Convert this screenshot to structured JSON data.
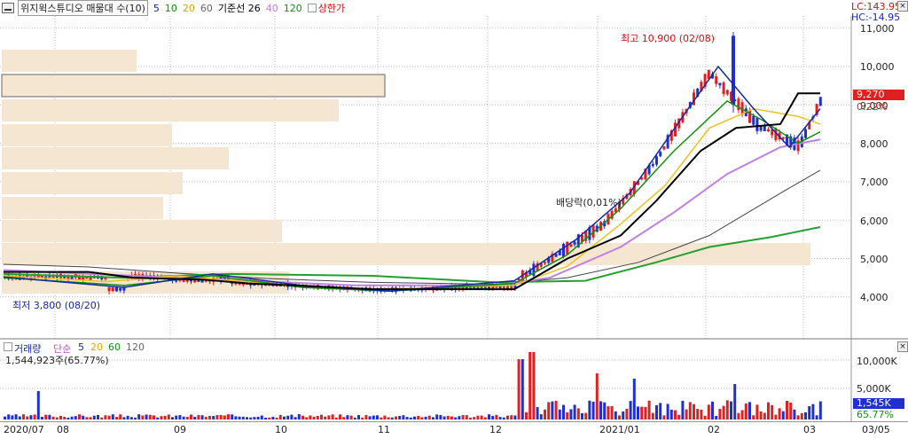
{
  "header": {
    "title": "위지윅스튜디오 매물대 수(10)",
    "ma_periods": [
      "5",
      "10",
      "20",
      "60"
    ],
    "kijun_label": "기준선 26",
    "extra_periods": [
      "40",
      "120"
    ],
    "limit_label": "상한가"
  },
  "corner": {
    "lc": "LC:143.95",
    "hc": "HC:-14.95"
  },
  "price_axis": {
    "ticks": [
      "11,000",
      "10,000",
      "9,000",
      "8,000",
      "7,000",
      "6,000",
      "5,000",
      "4,000"
    ]
  },
  "current": {
    "price": "9,270",
    "change": "0.22%"
  },
  "annotations": {
    "high": "최고 10,900 (02/08)",
    "low": "최저 3,800 (08/20)",
    "dividend": "배당락(0,01%)"
  },
  "volume": {
    "title": "거래량",
    "ma_label": "단순",
    "ma_periods": [
      "5",
      "20",
      "60",
      "120"
    ],
    "value": "1,544,923주(65.77%)",
    "axis_ticks": [
      "10,000K",
      "5,000K"
    ],
    "current": "1,545K",
    "current_pct": "65.77%"
  },
  "date_axis": {
    "ticks": [
      "2020/07",
      "08",
      "09",
      "10",
      "11",
      "12",
      "2021/01",
      "02",
      "03",
      "03/05"
    ]
  },
  "colors": {
    "up": "#e02020",
    "down": "#2030d0",
    "ma5": "#1428a0",
    "ma10": "#109010",
    "ma20": "#f0c020",
    "ma60": "#c080e0",
    "ma120": "#444444",
    "kijun": "#000000",
    "ma_green": "#22a030",
    "volume_profile": "#f5e6d2"
  }
}
